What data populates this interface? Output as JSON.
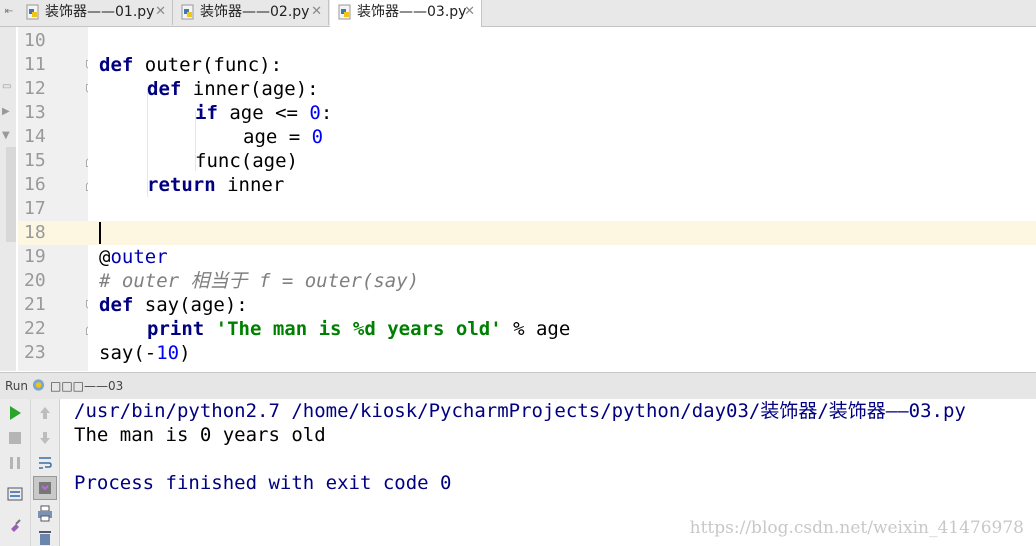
{
  "tabs": [
    {
      "label": "装饰器——01.py",
      "active": false
    },
    {
      "label": "装饰器——02.py",
      "active": false
    },
    {
      "label": "装饰器——03.py",
      "active": true
    }
  ],
  "editor": {
    "line_numbers": [
      "10",
      "11",
      "12",
      "13",
      "14",
      "15",
      "16",
      "17",
      "18",
      "19",
      "20",
      "21",
      "22",
      "23"
    ],
    "current_line": "18"
  },
  "code": {
    "l11": {
      "kw": "def",
      "rest": " outer(func):"
    },
    "l12": {
      "kw": "def",
      "rest": " inner(age):"
    },
    "l13": {
      "kw": "if",
      "mid": " age <= ",
      "num": "0",
      "end": ":"
    },
    "l14": {
      "pre": "age = ",
      "num": "0"
    },
    "l15": {
      "text": "func(age)"
    },
    "l16": {
      "kw": "return",
      "rest": " inner"
    },
    "l19": {
      "at": "@",
      "deco": "outer"
    },
    "l20": {
      "comment": "# outer 相当于 f = outer(say)"
    },
    "l21": {
      "kw": "def",
      "rest": " say(age):"
    },
    "l22": {
      "kw": "print",
      "str": "'The man is %d years old'",
      "rest": " % age"
    },
    "l23": {
      "pre": "say(-",
      "num": "10",
      "end": ")"
    }
  },
  "run": {
    "label": "Run",
    "config_name": "□□□——03"
  },
  "console": {
    "command": "/usr/bin/python2.7 /home/kiosk/PycharmProjects/python/day03/装饰器/装饰器——03.py",
    "output": "The man is 0 years old",
    "exit": "Process finished with exit code 0"
  },
  "watermark": "https://blog.csdn.net/weixin_41476978",
  "colors": {
    "keyword": "#000080",
    "number": "#0000ff",
    "string": "#008000",
    "comment": "#808080",
    "console_text": "#000080",
    "run_green": "#2aa52a"
  },
  "icons": [
    "python-file-icon",
    "close-icon",
    "run-icon",
    "stop-icon",
    "pause-icon",
    "up-arrow-icon",
    "down-arrow-icon",
    "soft-wrap-icon",
    "scroll-to-end-icon",
    "print-icon",
    "trash-icon",
    "layout-icon",
    "pin-icon"
  ]
}
